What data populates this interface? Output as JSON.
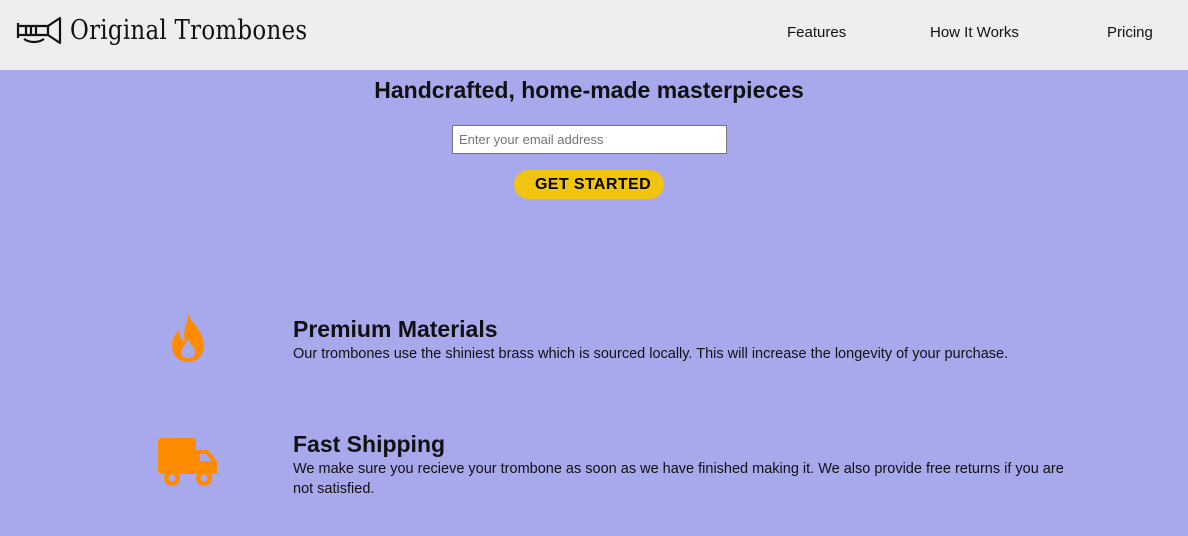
{
  "header": {
    "brand": "Original Trombones",
    "logo_icon": "trombone-icon",
    "nav": [
      {
        "label": "Features"
      },
      {
        "label": "How It Works"
      },
      {
        "label": "Pricing"
      }
    ]
  },
  "hero": {
    "title": "Handcrafted, home-made masterpieces",
    "email_placeholder": "Enter your email address",
    "email_value": "",
    "cta_label": "GET STARTED"
  },
  "features": [
    {
      "icon": "fire-icon",
      "title": "Premium Materials",
      "description": "Our trombones use the shiniest brass which is sourced locally. This will increase the longevity of your purchase."
    },
    {
      "icon": "truck-icon",
      "title": "Fast Shipping",
      "description": "We make sure you recieve your trombone as soon as we have finished making it. We also provide free returns if you are not satisfied."
    }
  ],
  "colors": {
    "page_background": "#a8a8ed",
    "header_background": "#eeeeee",
    "cta_background": "#f1c40f",
    "icon_accent": "#ff8c00"
  }
}
